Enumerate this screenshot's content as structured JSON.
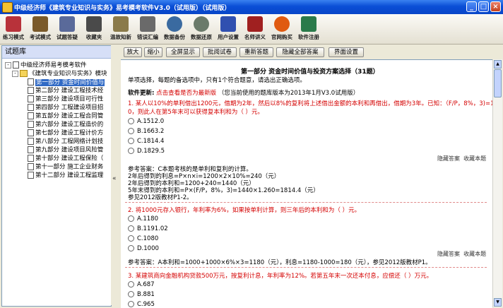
{
  "window": {
    "title": "中级经济师《建筑专业知识与实务》易考模考软件V3.0（试用版）（试用版）",
    "controls": [
      "_",
      "□",
      "×"
    ]
  },
  "toolbar": [
    {
      "label": "练习模式",
      "icon": "books-icon",
      "color": "#b8323a"
    },
    {
      "label": "考试模式",
      "icon": "scroll-icon",
      "color": "#7a5a2a"
    },
    {
      "label": "试题答疑",
      "icon": "notes-icon",
      "color": "#5a6a9a"
    },
    {
      "label": "收藏夹",
      "icon": "bag-icon",
      "color": "#4a4a4a"
    },
    {
      "label": "温故知新",
      "icon": "pen-icon",
      "color": "#8a7a4a"
    },
    {
      "label": "错误汇编",
      "icon": "glasses-icon",
      "color": "#6a6a6a"
    },
    {
      "label": "数据备份",
      "icon": "disc-icon",
      "color": "#3a6aa0"
    },
    {
      "label": "数据还原",
      "icon": "refresh-icon",
      "color": "#6a7a6a"
    },
    {
      "label": "用户设置",
      "icon": "settings-icon",
      "color": "#3050b0"
    },
    {
      "label": "名师讲义",
      "icon": "teacher-icon",
      "color": "#a02020"
    },
    {
      "label": "官网购买",
      "icon": "ie-icon",
      "color": "#e05a10"
    },
    {
      "label": "软件注册",
      "icon": "people-icon",
      "color": "#2a7a4a"
    }
  ],
  "left_panel": {
    "title": "试题库",
    "root": "中级经济师易考模考软件",
    "book": "《建筑专业知识与实务》模块",
    "chapters": [
      "第一部分 资金时间价值与",
      "第二部分 建设工程技术经",
      "第三部分 建设项目可行性",
      "第四部分 工程建设项目招",
      "第五部分 建设工程合同管",
      "第六部分 建设工程造价的",
      "第七部分 建设工程计价方",
      "第八部分 工程网络计划技",
      "第九部分 建设项目风险管",
      "第十部分 建设工程保险（",
      "第十一部分 施工企业财务",
      "第十二部分 建设工程监理"
    ],
    "selected_index": 0
  },
  "action_buttons": [
    "放大",
    "缩小",
    "全屏显示",
    "批阅试卷",
    "重新答题",
    "隐藏全部答案",
    "界面设置"
  ],
  "content": {
    "heading": "第一部分 资金时间价值与投资方案选择（31题）",
    "subheading": "单项选择，每题的备选项中，只有1个符合题意，请选出正确选项。",
    "update_label": "软件更新:",
    "update_link": "点击查看是否为最新版",
    "update_note": "（您当前使用的题库版本为2013年1月V3.0试用版）",
    "hide_answer": "隐藏答案",
    "collect": "收藏本题",
    "questions": [
      {
        "stem": [
          "1. 某人以10%的单利借出1200元，借期为2年，然后以8%的复利将上述借出金额的本利和再借出，借期为3年。已知：（F/P，8%，3)=1.26",
          "0，则此人在第5年末可以获得复本利和为（   ）元。"
        ],
        "options": [
          "A.1512.0",
          "B.1663.2",
          "C.1814.4",
          "D.1829.5"
        ],
        "answer": [
          "参考答案：C本题考核的是单利和复利的计算。",
          "2年后得到的利息=P×n×i=1200×2×10%=240（元）",
          "2年后得到的本利和=1200+240=1440（元）",
          "5年末得到的本利和=P×(F/P，8%，3)=1440×1.260=1814.4（元）",
          "参见2012版教材P1-2。"
        ]
      },
      {
        "stem": [
          "2. 将1000元存入银行，年利率为6%，如果按单利计算，则三年后的本利和为（   ）元。"
        ],
        "options": [
          "A.1180",
          "B.1191.02",
          "C.1080",
          "D.1000"
        ],
        "answer": [
          "参考答案：A本利和=1000+1000×6%×3=1180（元），利息=1180-1000=180（元），参见2012版教材P1。"
        ]
      },
      {
        "stem": [
          "3. 某建筑商向金融机构贷款500万元，按复利计息，年利率为12%。若第五年末一次还本付息，应偿还（   ）万元。"
        ],
        "options": [
          "A.687",
          "B.881",
          "C.965"
        ],
        "answer": []
      }
    ]
  }
}
